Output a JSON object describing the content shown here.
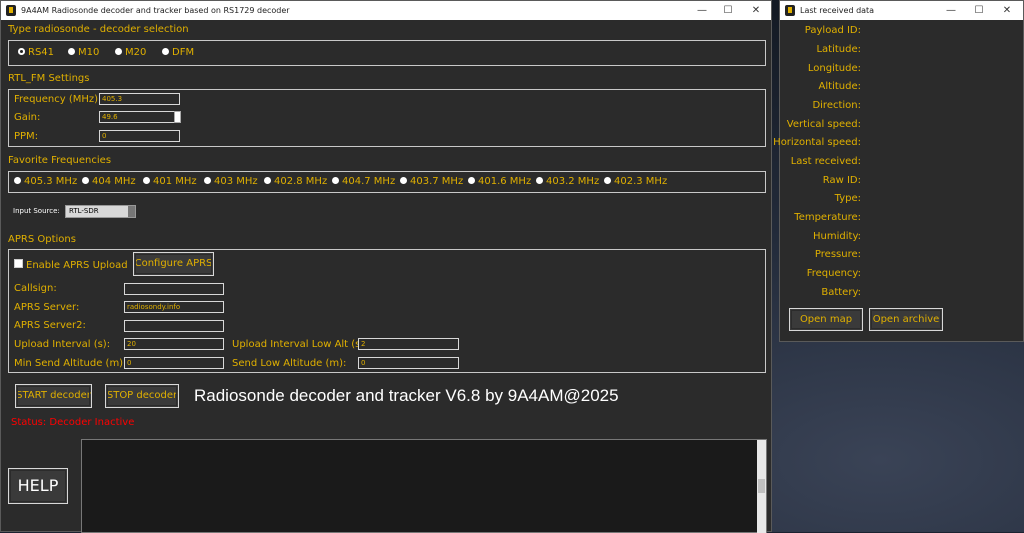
{
  "main_window": {
    "title": "9A4AM Radiosonde decoder and tracker based on RS1729 decoder",
    "minimize": "—",
    "maximize": "☐",
    "close": "✕"
  },
  "decoder_selection": {
    "title": "Type radiosonde - decoder selection",
    "options": [
      "RS41",
      "M10",
      "M20",
      "DFM"
    ],
    "selected": "RS41"
  },
  "rtl_fm": {
    "title": "RTL_FM Settings",
    "frequency_label": "Frequency (MHz):",
    "frequency_value": "405.3",
    "gain_label": "Gain:",
    "gain_value": "49.6",
    "ppm_label": "PPM:",
    "ppm_value": "0"
  },
  "favorites": {
    "title": "Favorite Frequencies",
    "items": [
      "405.3 MHz",
      "404 MHz",
      "401 MHz",
      "403 MHz",
      "402.8 MHz",
      "404.7 MHz",
      "403.7 MHz",
      "401.6 MHz",
      "403.2 MHz",
      "402.3 MHz"
    ]
  },
  "input_source": {
    "label": "Input Source:",
    "value": "RTL-SDR"
  },
  "aprs": {
    "title": "APRS Options",
    "enable_label": "Enable APRS Upload",
    "configure_label": "Configure APRS",
    "callsign_label": "Callsign:",
    "callsign_value": "",
    "server_label": "APRS Server:",
    "server_value": "radiosondy.info",
    "server2_label": "APRS Server2:",
    "server2_value": "",
    "upload_interval_label": "Upload Interval (s):",
    "upload_interval_value": "20",
    "upload_interval_low_label": "Upload Interval Low Alt (s):",
    "upload_interval_low_value": "2",
    "min_send_alt_label": "Min Send Altitude (m):",
    "min_send_alt_value": "0",
    "send_low_alt_label": "Send Low Altitude (m):",
    "send_low_alt_value": "0"
  },
  "controls": {
    "start_label": "START decoder",
    "stop_label": "STOP decoder",
    "banner": "Radiosonde decoder and tracker V6.8 by 9A4AM@2025",
    "status": "Status: Decoder Inactive",
    "help_label": "HELP"
  },
  "data_window": {
    "title": "Last received data",
    "fields": [
      "Payload ID:",
      "Latitude:",
      "Longitude:",
      "Altitude:",
      "Direction:",
      "Vertical speed:",
      "Horizontal speed:",
      "Last received:",
      "Raw ID:",
      "Type:",
      "Temperature:",
      "Humidity:",
      "Pressure:",
      "Frequency:",
      "Battery:"
    ],
    "open_map_label": "Open map",
    "open_archive_label": "Open archive"
  },
  "colors": {
    "accent": "#e0b000",
    "status": "#ff0000",
    "background": "#2b2b2b"
  }
}
